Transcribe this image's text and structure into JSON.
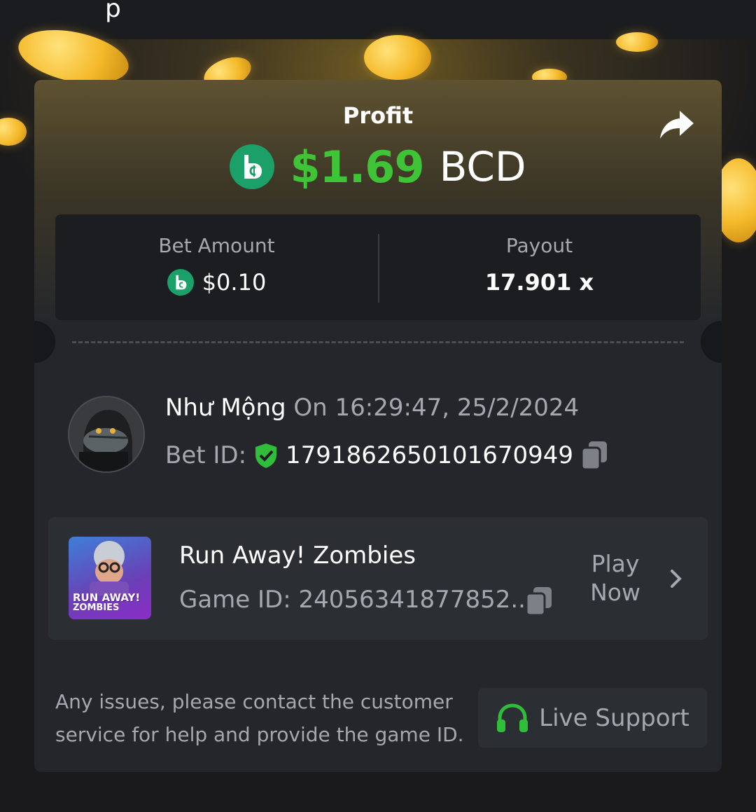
{
  "header": {
    "partial_title": "p"
  },
  "card": {
    "profit_label": "Profit",
    "profit_amount": "$1.69",
    "profit_currency": "BCD",
    "bet_amount_label": "Bet Amount",
    "bet_amount_value": "$0.10",
    "payout_label": "Payout",
    "payout_value": "17.901 x"
  },
  "bet": {
    "user_name": "Như Mộng",
    "timestamp": "On 16:29:47, 25/2/2024",
    "bet_id_label": "Bet ID:",
    "bet_id_value": "1791862650101670949"
  },
  "game": {
    "title": "Run Away! Zombies",
    "game_id_text": "Game ID: 24056341877852...",
    "thumb_line1": "RUN AWAY!",
    "thumb_line2": "ZOMBIES",
    "play_now_line1": "Play",
    "play_now_line2": "Now"
  },
  "footer": {
    "note_line1": "Any issues, please contact the customer",
    "note_line2": "service for help and provide the game ID.",
    "live_support_label": "Live Support"
  },
  "icons": {
    "share": "share-icon",
    "currency": "bcd-coin-icon",
    "verified": "shield-check-icon",
    "copy": "copy-icon",
    "chevron": "chevron-right-icon",
    "headset": "headset-icon"
  },
  "colors": {
    "profit_green": "#3ec436",
    "coin_teal": "#1aa068",
    "card_bg": "#24262b",
    "muted_text": "#a5a8ae"
  }
}
